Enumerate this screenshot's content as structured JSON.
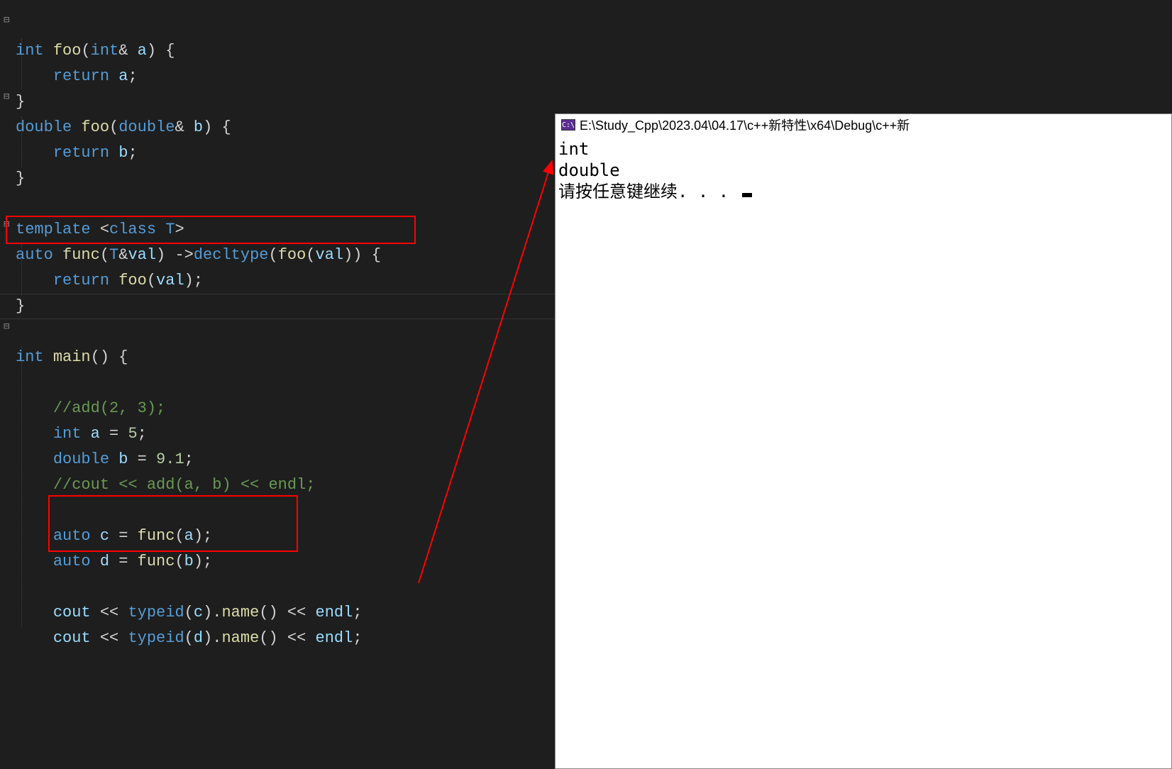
{
  "code": {
    "l1a": "int",
    "l1b": " ",
    "l1c": "foo",
    "l1d": "(",
    "l1e": "int",
    "l1f": "& ",
    "l1g": "a",
    "l1h": ") {",
    "l2a": "    ",
    "l2b": "return",
    "l2c": " ",
    "l2d": "a",
    "l2e": ";",
    "l3a": "}",
    "l4a": "double",
    "l4b": " ",
    "l4c": "foo",
    "l4d": "(",
    "l4e": "double",
    "l4f": "& ",
    "l4g": "b",
    "l4h": ") {",
    "l5a": "    ",
    "l5b": "return",
    "l5c": " ",
    "l5d": "b",
    "l5e": ";",
    "l6a": "}",
    "l7a": "",
    "l8a": "template",
    "l8b": " <",
    "l8c": "class",
    "l8d": " ",
    "l8e": "T",
    "l8f": ">",
    "l9a": "auto",
    "l9b": " ",
    "l9c": "func",
    "l9d": "(",
    "l9e": "T",
    "l9f": "&",
    "l9g": "val",
    "l9h": ") ->",
    "l9i": "decltype",
    "l9j": "(",
    "l9k": "foo",
    "l9l": "(",
    "l9m": "val",
    "l9n": ")) {",
    "l10a": "    ",
    "l10b": "return",
    "l10c": " ",
    "l10d": "foo",
    "l10e": "(",
    "l10f": "val",
    "l10g": ");",
    "l11a": "}",
    "l12a": "",
    "l13a": "int",
    "l13b": " ",
    "l13c": "main",
    "l13d": "() {",
    "l14a": "",
    "l15a": "    ",
    "l15b": "//add(2, 3);",
    "l16a": "    ",
    "l16b": "int",
    "l16c": " ",
    "l16d": "a",
    "l16e": " = ",
    "l16f": "5",
    "l16g": ";",
    "l17a": "    ",
    "l17b": "double",
    "l17c": " ",
    "l17d": "b",
    "l17e": " = ",
    "l17f": "9.1",
    "l17g": ";",
    "l18a": "    ",
    "l18b": "//cout << add(a, b) << endl;",
    "l19a": "",
    "l20a": "    ",
    "l20b": "auto",
    "l20c": " ",
    "l20d": "c",
    "l20e": " = ",
    "l20f": "func",
    "l20g": "(",
    "l20h": "a",
    "l20i": ");",
    "l21a": "    ",
    "l21b": "auto",
    "l21c": " ",
    "l21d": "d",
    "l21e": " = ",
    "l21f": "func",
    "l21g": "(",
    "l21h": "b",
    "l21i": ");",
    "l22a": "",
    "l23a": "    ",
    "l23b": "cout",
    "l23c": " << ",
    "l23d": "typeid",
    "l23e": "(",
    "l23f": "c",
    "l23g": ").",
    "l23h": "name",
    "l23i": "() << ",
    "l23j": "endl",
    "l23k": ";",
    "l24a": "    ",
    "l24b": "cout",
    "l24c": " << ",
    "l24d": "typeid",
    "l24e": "(",
    "l24f": "d",
    "l24g": ").",
    "l24h": "name",
    "l24i": "() << ",
    "l24j": "endl",
    "l24k": ";"
  },
  "console": {
    "icon": "C:\\",
    "title": "E:\\Study_Cpp\\2023.04\\04.17\\c++新特性\\x64\\Debug\\c++新",
    "line1": "int",
    "line2": "double",
    "line3": "请按任意键继续. . . "
  },
  "fold": {
    "minus": "⊟",
    "plus": "⊞"
  }
}
